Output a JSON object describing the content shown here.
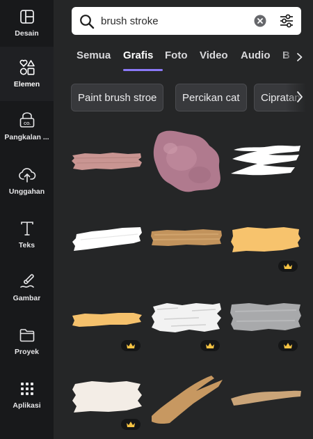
{
  "sidebar": {
    "items": [
      {
        "label": "Desain",
        "icon": "layout-icon"
      },
      {
        "label": "Elemen",
        "icon": "shapes-icon"
      },
      {
        "label": "Pangkalan ...",
        "icon": "brand-kit-icon"
      },
      {
        "label": "Unggahan",
        "icon": "cloud-upload-icon"
      },
      {
        "label": "Teks",
        "icon": "text-icon"
      },
      {
        "label": "Gambar",
        "icon": "draw-icon"
      },
      {
        "label": "Proyek",
        "icon": "folder-icon"
      },
      {
        "label": "Aplikasi",
        "icon": "apps-grid-icon"
      }
    ],
    "active_index": 1
  },
  "search": {
    "value": "brush stroke",
    "placeholder": ""
  },
  "tabs": [
    "Semua",
    "Grafis",
    "Foto",
    "Video",
    "Audio",
    "B"
  ],
  "active_tab": "Grafis",
  "chips": [
    "Paint brush stroe",
    "Percikan cat",
    "Cipratan"
  ],
  "results": [
    {
      "name": "pink-brush-stroke",
      "color": "#c99592",
      "premium": false
    },
    {
      "name": "mauve-watercolor-blot",
      "color": "#b07a8e",
      "premium": false
    },
    {
      "name": "white-dry-brush-stroke",
      "color": "#ffffff",
      "premium": false
    },
    {
      "name": "white-brush-stroke",
      "color": "#ffffff",
      "premium": false
    },
    {
      "name": "tan-brush-stroke",
      "color": "#c2935c",
      "premium": false
    },
    {
      "name": "yellow-brush-stroke",
      "color": "#f7c36d",
      "premium": true
    },
    {
      "name": "yellow-thin-brush-stroke",
      "color": "#f5c16c",
      "premium": true
    },
    {
      "name": "white-grunge-stroke",
      "color": "#f2f2f2",
      "premium": true
    },
    {
      "name": "gray-brush-stroke",
      "color": "#a8a9ab",
      "premium": true
    },
    {
      "name": "cream-brush-stroke",
      "color": "#f3ede6",
      "premium": true
    },
    {
      "name": "tan-diagonal-stroke",
      "color": "#c79861",
      "premium": false
    },
    {
      "name": "tan-wavy-stroke",
      "color": "#caa478",
      "premium": false
    }
  ],
  "colors": {
    "accent": "#8b79f7",
    "crown": "#f6c343",
    "panel": "#252627",
    "sidebar": "#18191b"
  }
}
